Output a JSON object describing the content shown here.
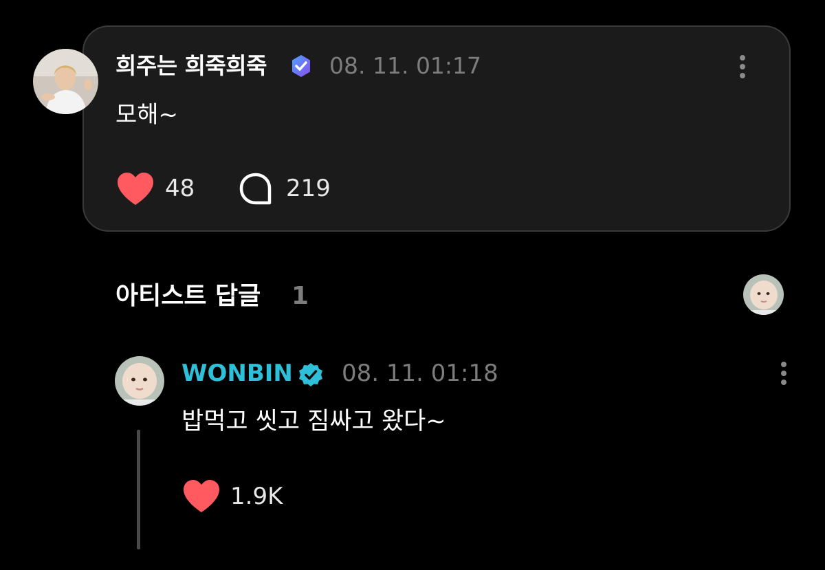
{
  "post": {
    "author": "희주는 희죽희죽",
    "timestamp": "08. 11. 01:17",
    "text": "모해~",
    "likes": "48",
    "comments": "219",
    "avatar": "user-avatar-photo",
    "badge_icon": "membership-badge-icon"
  },
  "artist_replies": {
    "title": "아티스트 답글",
    "count": "1"
  },
  "reply": {
    "author": "WONBIN",
    "timestamp": "08. 11. 01:18",
    "text": "밥먹고 씻고 짐싸고 왔다~",
    "likes": "1.9K",
    "badge_icon": "verified-artist-icon"
  },
  "colors": {
    "background": "#000000",
    "card": "#1b1b1b",
    "card_border": "#3a3a3a",
    "heart": "#ff5a5f",
    "artist_name": "#2ec0d9",
    "muted": "#7d7d7d",
    "membership_badge": "#6b5cf6"
  }
}
